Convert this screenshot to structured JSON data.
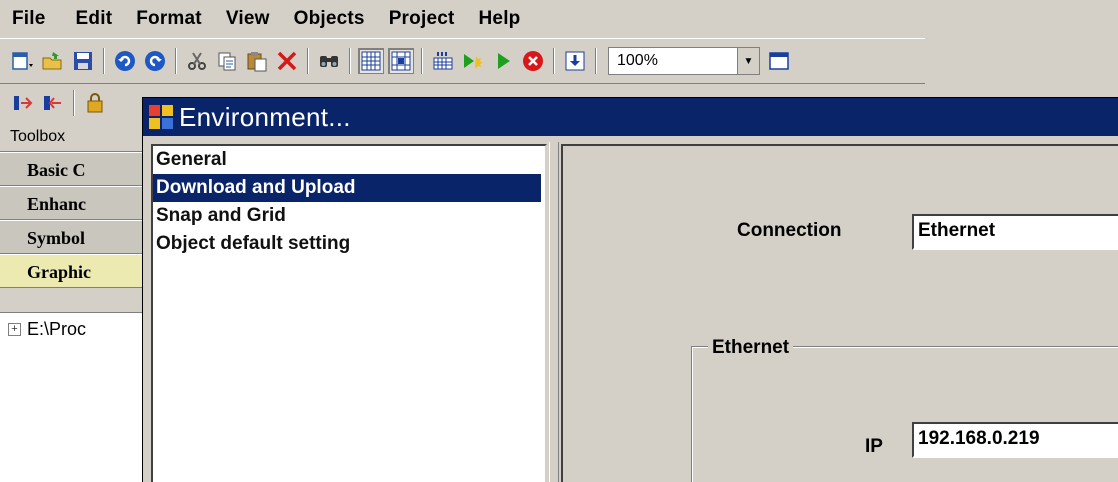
{
  "menubar": {
    "items": [
      "File",
      "Edit",
      "Format",
      "View",
      "Objects",
      "Project",
      "Help"
    ]
  },
  "toolbar": {
    "zoom_value": "100%"
  },
  "toolbox": {
    "header": "Toolbox",
    "categories": [
      "Basic C",
      "Enhanc",
      "Symbol",
      "Graphic"
    ],
    "tree_item": "E:\\Proc"
  },
  "dialog": {
    "title": "Environment...",
    "list_items": [
      "General",
      "Download and Upload",
      "Snap and Grid",
      "Object default setting"
    ],
    "selected_index": 1,
    "connection_label": "Connection",
    "connection_value": "Ethernet",
    "group_label": "Ethernet",
    "ip_label": "IP",
    "ip_value": "192.168.0.219"
  },
  "colors": {
    "title_bar": "#0a246a",
    "selection": "#0a246a",
    "face": "#d4d0c8",
    "active_category": "#eceab1"
  }
}
